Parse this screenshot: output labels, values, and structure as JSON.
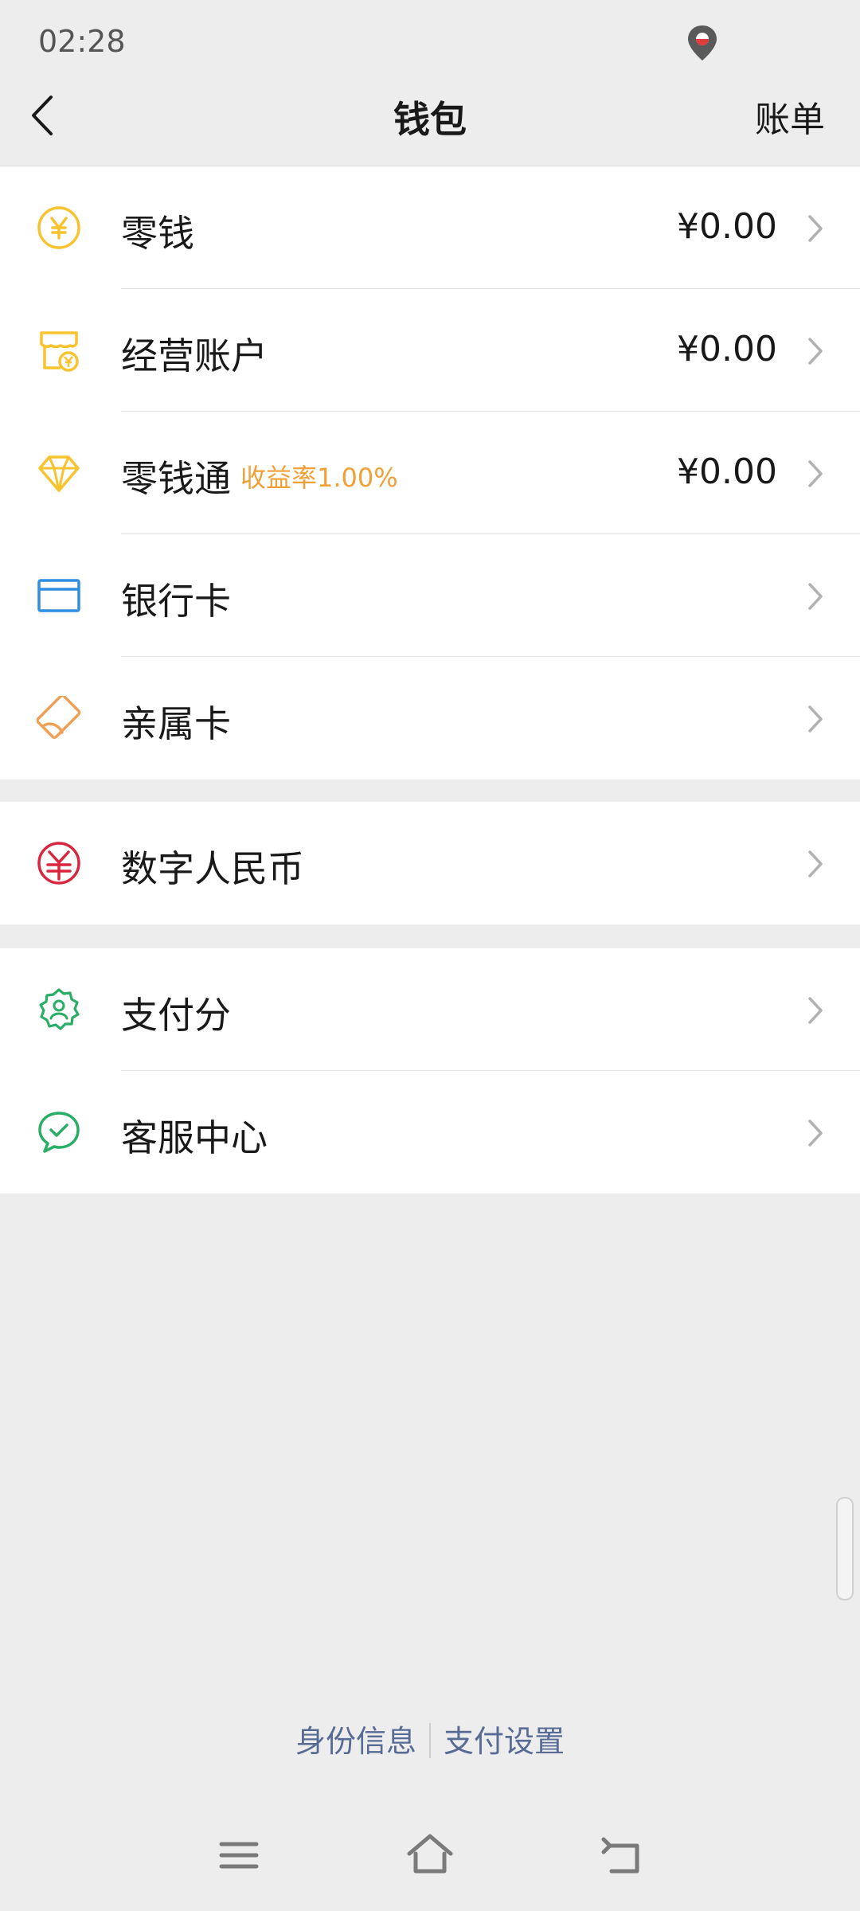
{
  "status_bar": {
    "time": "02:28",
    "icons": [
      "location-icon"
    ]
  },
  "nav": {
    "title": "钱包",
    "right_link": "账单",
    "back_icon": "chevron-left-icon"
  },
  "groups": [
    {
      "items": [
        {
          "id": "change",
          "label": "零钱",
          "value": "¥0.00",
          "icon": "yuan-coin-icon",
          "icon_color": "#f7c32e"
        },
        {
          "id": "business-account",
          "label": "经营账户",
          "value": "¥0.00",
          "icon": "shop-icon",
          "icon_color": "#f7c32e"
        },
        {
          "id": "lingqiantong",
          "label": "零钱通",
          "tag": "收益率1.00%",
          "value": "¥0.00",
          "icon": "diamond-icon",
          "icon_color": "#f7c32e"
        },
        {
          "id": "bank-card",
          "label": "银行卡",
          "value": "",
          "icon": "bank-card-icon",
          "icon_color": "#2f8ee0"
        },
        {
          "id": "family-card",
          "label": "亲属卡",
          "value": "",
          "icon": "family-card-icon",
          "icon_color": "#f0a056"
        }
      ]
    },
    {
      "items": [
        {
          "id": "digital-rmb",
          "label": "数字人民币",
          "value": "",
          "icon": "digital-rmb-icon",
          "icon_color": "#d9263f"
        }
      ]
    },
    {
      "items": [
        {
          "id": "pay-score",
          "label": "支付分",
          "value": "",
          "icon": "pay-score-icon",
          "icon_color": "#2aae67"
        },
        {
          "id": "service-center",
          "label": "客服中心",
          "value": "",
          "icon": "service-chat-icon",
          "icon_color": "#2aae67"
        }
      ]
    }
  ],
  "footer": {
    "identity": "身份信息",
    "pay_settings": "支付设置"
  },
  "system_nav": [
    "menu-icon",
    "home-icon",
    "back-icon"
  ],
  "colors": {
    "background": "#ededed",
    "link": "#576b95",
    "tag": "#f0a035"
  }
}
